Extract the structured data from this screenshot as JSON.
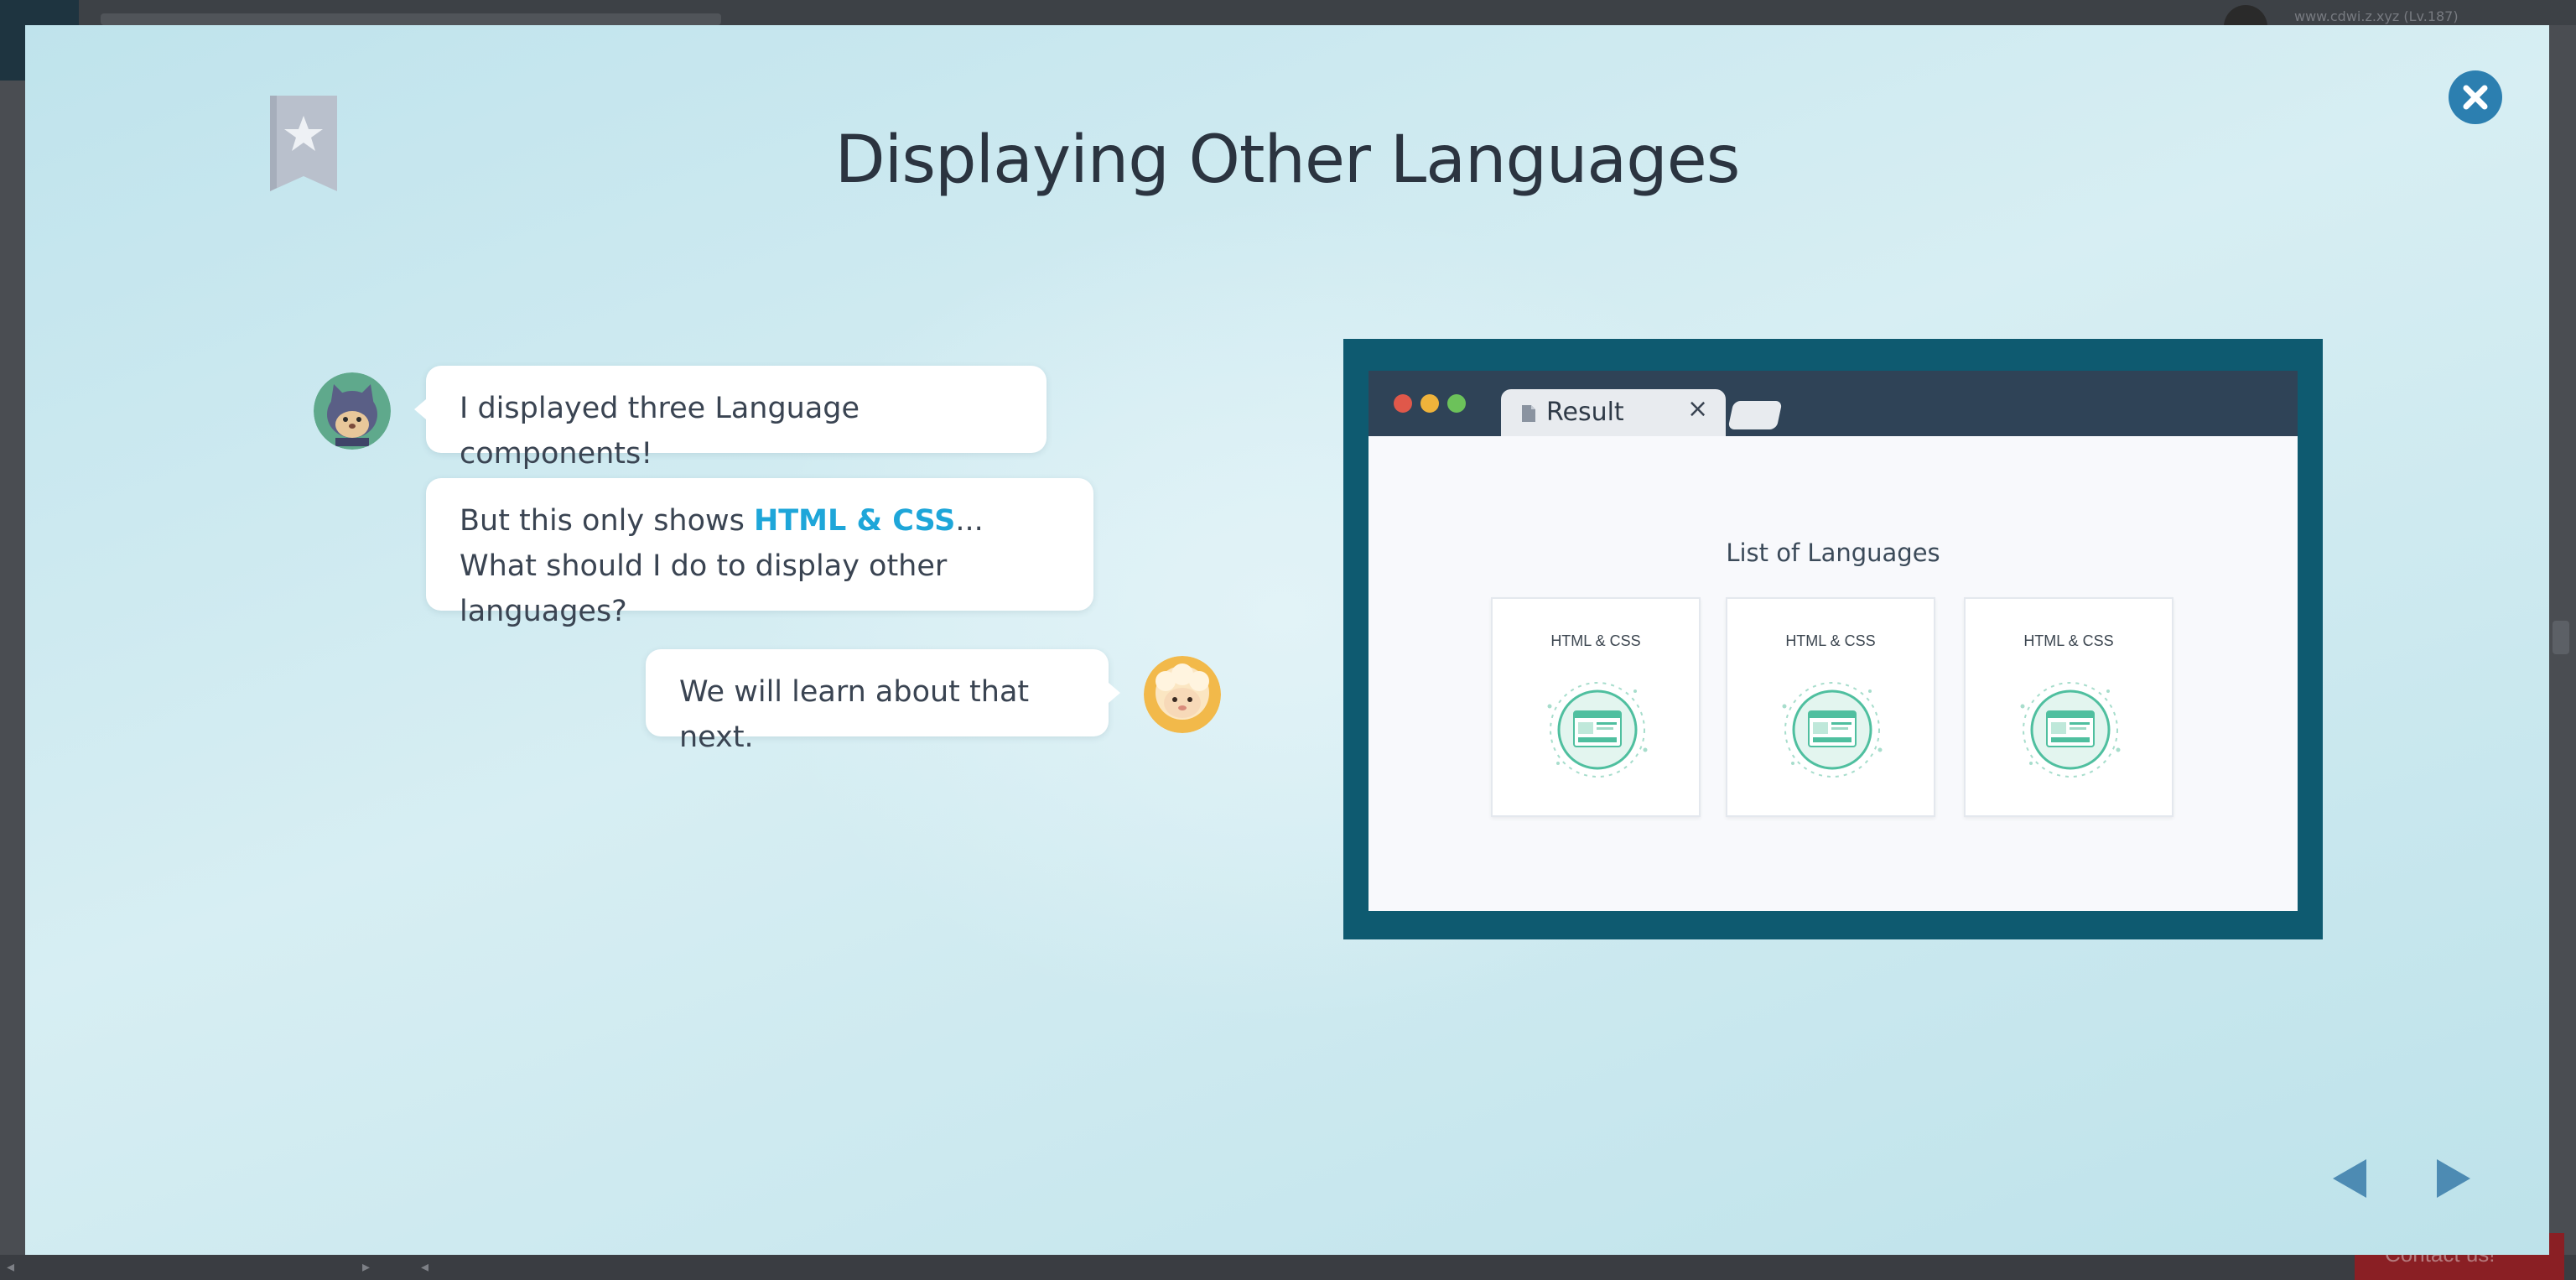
{
  "background": {
    "user_text": "www.cdwi.z.xyz (Lv.187)",
    "contact_label": "Contact us!"
  },
  "modal": {
    "title": "Displaying Other Languages",
    "bookmark_icon": "bookmark-star-icon",
    "close_icon": "close-icon"
  },
  "chat": {
    "messages": [
      {
        "speaker": "ninja-cat",
        "side": "left",
        "text": "I displayed three Language components!"
      },
      {
        "speaker": "ninja-cat",
        "side": "left",
        "text_before": "But this only shows ",
        "highlight": "HTML & CSS",
        "text_after": "... What should I do to display other languages?"
      },
      {
        "speaker": "sheep",
        "side": "right",
        "text": "We will learn about that next."
      }
    ]
  },
  "browser": {
    "tab_label": "Result",
    "tab_close": "×",
    "list_title": "List of Languages",
    "cards": [
      {
        "name": "HTML & CSS"
      },
      {
        "name": "HTML & CSS"
      },
      {
        "name": "HTML & CSS"
      }
    ]
  },
  "navigation": {
    "prev_icon": "triangle-left-icon",
    "next_icon": "triangle-right-icon"
  },
  "colors": {
    "accent": "#1ea6d9",
    "close_button": "#2c7fb0",
    "frame": "#0e5a70",
    "chrome": "#2f4357",
    "card_green": "#4fbf9f"
  }
}
